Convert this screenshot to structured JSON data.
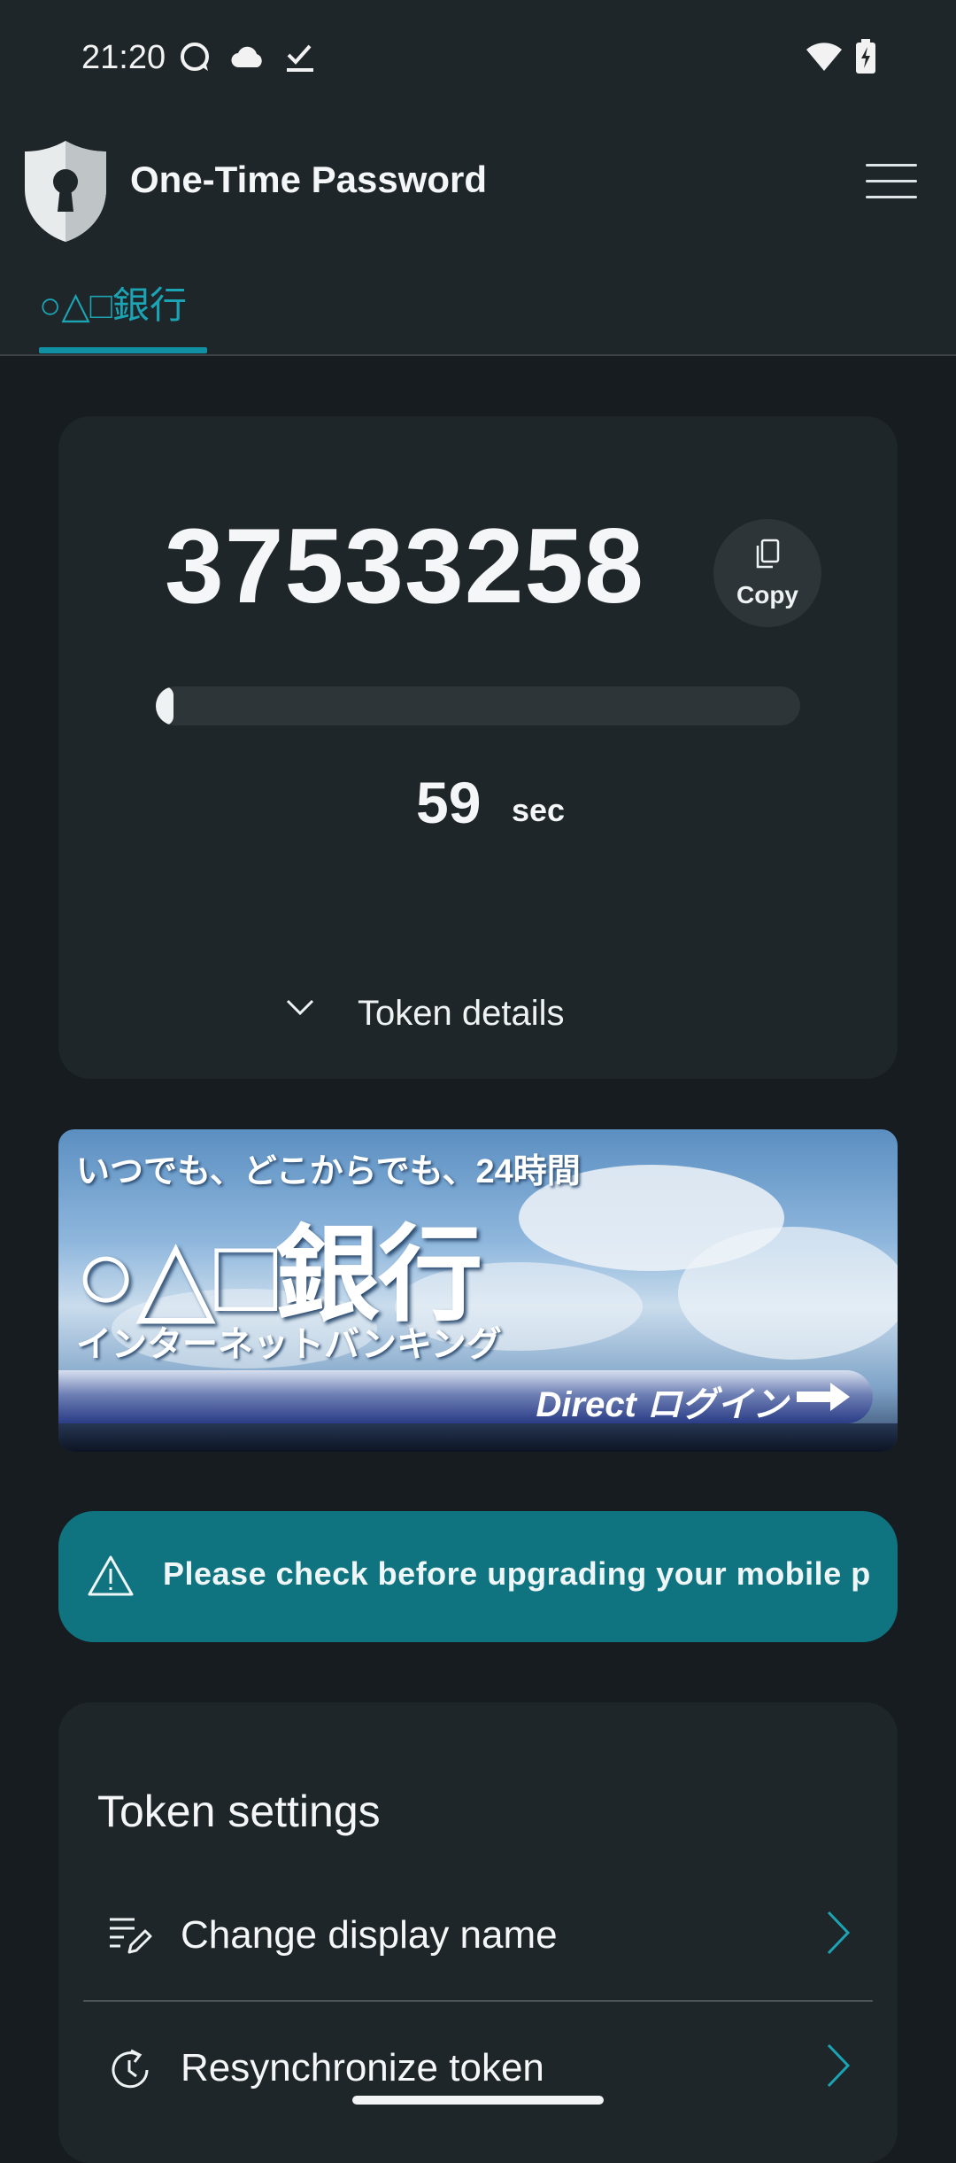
{
  "status_bar": {
    "time": "21:20",
    "left_icons": [
      "message-icon",
      "cloud-icon",
      "task-check-icon"
    ],
    "right_icons": [
      "wifi-icon",
      "battery-charging-icon"
    ]
  },
  "header": {
    "title": "One-Time Password",
    "logo_icon": "shield-keyhole-icon",
    "menu_icon": "hamburger-menu-icon"
  },
  "tabs": [
    {
      "label": "○△□銀行",
      "selected": true
    }
  ],
  "otp": {
    "code": "37533258",
    "copy_label": "Copy",
    "progress": 0.02,
    "countdown": "59",
    "countdown_unit": "sec",
    "details_label": "Token details"
  },
  "banner": {
    "line1": "いつでも、どこからでも、24時間",
    "title": "○△□銀行",
    "line3": "インターネットバンキング",
    "login": "Direct ログイン"
  },
  "notice": {
    "text": "Please check before upgrading your mobile p",
    "icon": "warning-triangle-icon"
  },
  "settings": {
    "title": "Token settings",
    "items": [
      {
        "label": "Change display name",
        "icon": "list-edit-icon"
      },
      {
        "label": "Resynchronize token",
        "icon": "clock-sync-icon"
      }
    ]
  },
  "colors": {
    "background": "#161c1f",
    "surface": "#1f2629",
    "accent": "#1aa4b4",
    "notice": "#0f7480"
  }
}
